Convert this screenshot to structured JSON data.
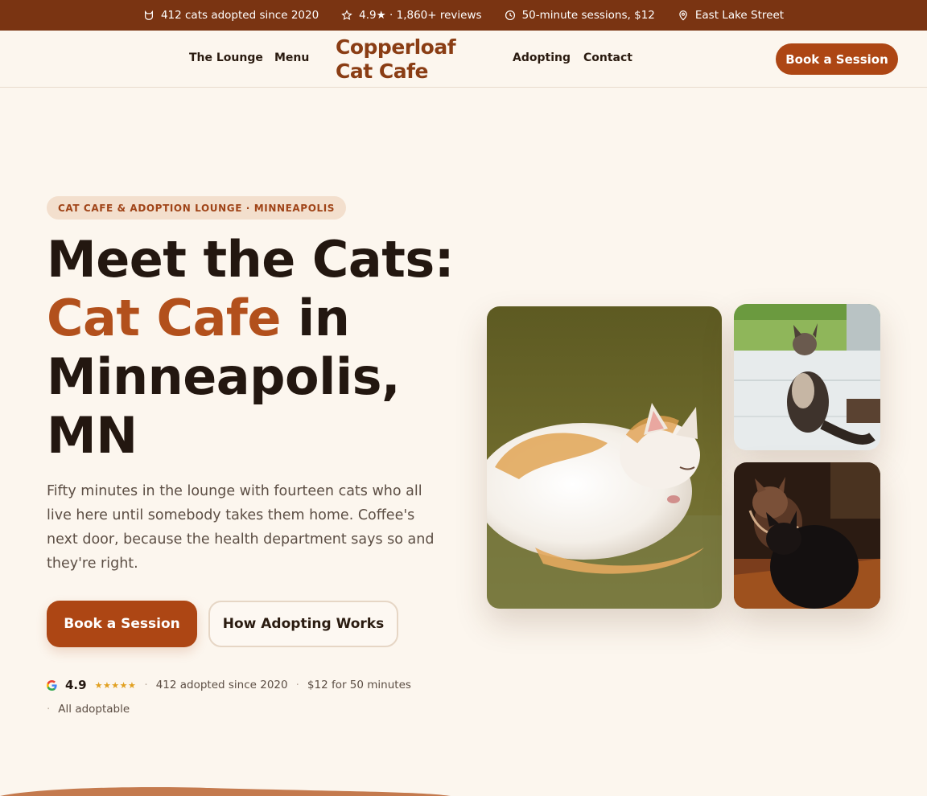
{
  "topbar": {
    "adopted": "412 cats adopted since 2020",
    "rating": "4.9★ · 1,860+ reviews",
    "sessions": "50-minute sessions, $12",
    "location": "East Lake Street"
  },
  "nav": {
    "lounge": "The Lounge",
    "menu": "Menu",
    "logo_line1": "Copperloaf",
    "logo_line2": "Cat Cafe",
    "adopting": "Adopting",
    "contact": "Contact",
    "cta": "Book a Session"
  },
  "hero": {
    "eyebrow": "CAT CAFE & ADOPTION LOUNGE · MINNEAPOLIS",
    "headline_part1": "Meet the Cats:",
    "headline_accent": "Cat Cafe",
    "headline_part2": " in Minneapolis, MN",
    "lede": "Fifty minutes in the lounge with fourteen cats who all live here until somebody takes them home. Coffee's next door, because the health department says so and they're right.",
    "primary_cta": "Book a Session",
    "secondary_cta": "How Adopting Works"
  },
  "stats": {
    "rating": "4.9",
    "stars": "★★★★★",
    "adopted": "412 adopted since 2020",
    "price": "$12 for 50 minutes",
    "adoptable": "All adoptable"
  },
  "colors": {
    "topbar": "#7a3412",
    "accent": "#ad4614",
    "background": "#fcf6ee"
  }
}
